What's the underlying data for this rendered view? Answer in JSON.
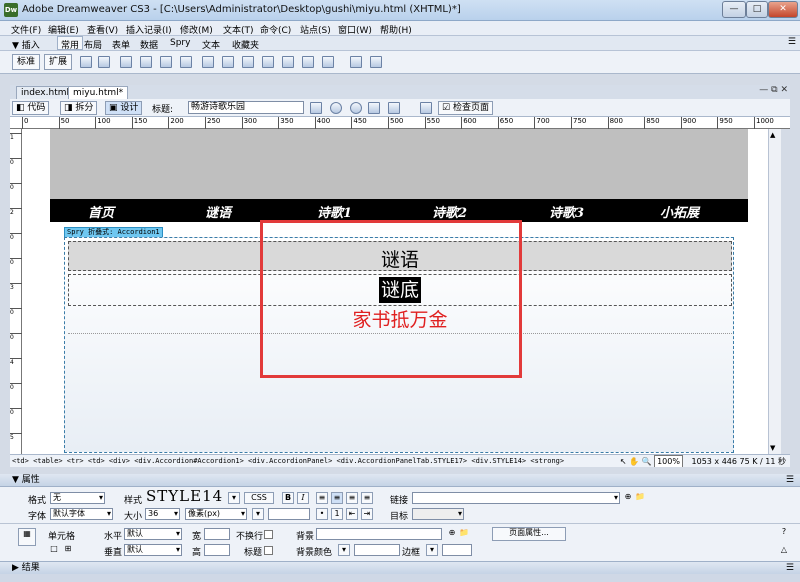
{
  "window": {
    "app_icon_text": "Dw",
    "title": "Adobe Dreamweaver CS3 - [C:\\Users\\Administrator\\Desktop\\gushi\\miyu.html (XHTML)*]",
    "min_label": "—",
    "max_label": "□",
    "close_label": "✕"
  },
  "menubar": {
    "items": [
      "文件(F)",
      "编辑(E)",
      "查看(V)",
      "插入记录(I)",
      "修改(M)",
      "文本(T)",
      "命令(C)",
      "站点(S)",
      "窗口(W)",
      "帮助(H)"
    ]
  },
  "insertbar": {
    "label": "▼ 插入",
    "tabs": [
      "常用",
      "布局",
      "表单",
      "数据",
      "Spry",
      "文本",
      "收藏夹"
    ]
  },
  "toolbar": {
    "standard_label": "标准",
    "expanded_label": "扩展"
  },
  "document_tabs": [
    "index.html",
    "miyu.html*"
  ],
  "document_toolbar": {
    "code_label": "代码",
    "split_label": "拆分",
    "design_label": "设计",
    "title_label": "标题:",
    "title_value": "畅游诗歌乐园",
    "check_page_label": "检查页面"
  },
  "ruler_ticks": [
    "0",
    "50",
    "100",
    "150",
    "200",
    "250",
    "300",
    "350",
    "400",
    "450",
    "500",
    "550",
    "600",
    "650",
    "700",
    "750",
    "800",
    "850",
    "900",
    "950",
    "1000"
  ],
  "vruler_ticks": [
    "1",
    "0",
    "0",
    "2",
    "0",
    "0",
    "3",
    "0",
    "0",
    "4",
    "0",
    "0",
    "5"
  ],
  "page": {
    "nav_items": [
      "首页",
      "谜语",
      "诗歌1",
      "诗歌2",
      "诗歌3",
      "小拓展"
    ],
    "spry_label": "Spry 折叠式: Accordion1",
    "panel_tab_text": "谜语",
    "highlighted_text": "谜底",
    "content_text": "家书抵万金"
  },
  "statusbar": {
    "tag_path": "<td> <table> <tr> <td> <div> <div.Accordion#Accordion1> <div.AccordionPanel> <div.AccordionPanelTab.STYLE17> <div.STYLE14> <strong>",
    "zoom": "100%",
    "dimensions": "1053 x 446",
    "filesize": "75 K / 11 秒"
  },
  "properties": {
    "header": "▼ 属性",
    "format_label": "格式",
    "format_value": "无",
    "style_label": "样式",
    "style_preview": "STYLE14",
    "css_label": "CSS",
    "bold_label": "B",
    "italic_label": "I",
    "link_label": "链接",
    "font_label": "字体",
    "font_value": "默认字体",
    "size_label": "大小",
    "size_value": "36",
    "unit_value": "像素(px)",
    "target_label": "目标",
    "cell_label": "单元格",
    "horz_label": "水平",
    "horz_value": "默认",
    "width_label": "宽",
    "nowrap_label": "不换行",
    "bg_label": "背景",
    "page_props_label": "页面属性...",
    "vert_label": "垂直",
    "vert_value": "默认",
    "height_label": "高",
    "header_label": "标题",
    "bgcolor_label": "背景颜色",
    "border_label": "边框"
  },
  "results": {
    "label": "▶ 结果"
  },
  "colors": {
    "red_box": "#e23a3a",
    "content_red": "#e02020",
    "spry_label_bg": "#6fc7f0"
  }
}
